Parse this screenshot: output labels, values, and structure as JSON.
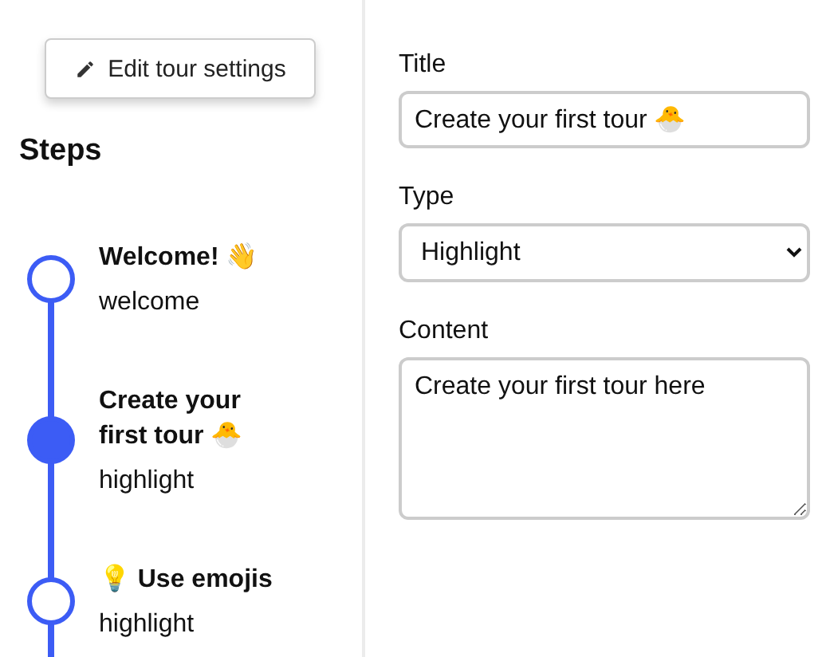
{
  "settings_button": {
    "label": "Edit tour settings"
  },
  "steps_heading": "Steps",
  "steps": [
    {
      "title": "Welcome! 👋",
      "type": "welcome",
      "selected": false
    },
    {
      "title": "Create your first tour 🐣",
      "type": "highlight",
      "selected": true
    },
    {
      "title": "💡 Use emojis",
      "type": "highlight",
      "selected": false
    }
  ],
  "form": {
    "title_label": "Title",
    "title_value": "Create your first tour 🐣",
    "type_label": "Type",
    "type_value": "Highlight",
    "content_label": "Content",
    "content_value": "Create your first tour here"
  }
}
